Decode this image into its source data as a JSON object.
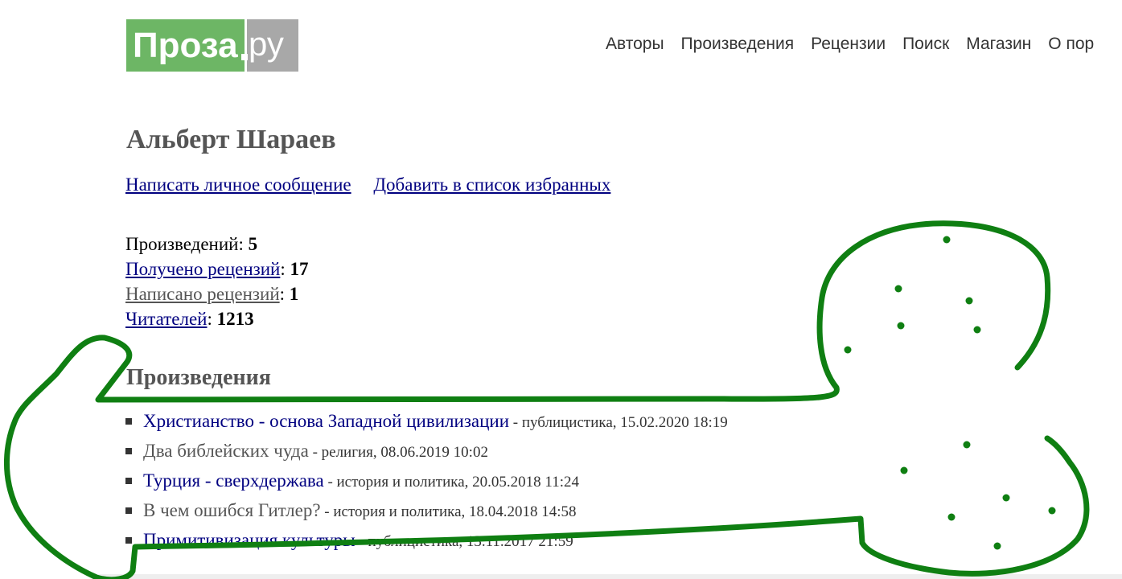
{
  "header": {
    "logo_main": "Проза",
    "logo_suffix": "ру",
    "nav": [
      "Авторы",
      "Произведения",
      "Рецензии",
      "Поиск",
      "Магазин",
      "О пор"
    ]
  },
  "author": {
    "name": "Альберт Шараев",
    "send_message": "Написать личное сообщение",
    "add_favorite": "Добавить в список избранных"
  },
  "stats": {
    "works_label": "Произведений",
    "works_value": "5",
    "reviews_received_label": "Получено рецензий",
    "reviews_received_value": "17",
    "reviews_written_label": "Написано рецензий",
    "reviews_written_value": "1",
    "readers_label": "Читателей",
    "readers_value": "1213"
  },
  "works_section": {
    "title": "Произведения",
    "items": [
      {
        "title": "Христианство - основа Западной цивилизации",
        "meta": " - публицистика, 15.02.2020 18:19"
      },
      {
        "title": "Два библейских чуда",
        "meta": " - религия, 08.06.2019 10:02"
      },
      {
        "title": "Турция - сверхдержава",
        "meta": " - история и политика, 20.05.2018 11:24"
      },
      {
        "title": "В чем ошибся Гитлер?",
        "meta": " - история и политика, 18.04.2018 14:58"
      },
      {
        "title": "Примитивизация культуры",
        "meta": " - публицистика, 13.11.2017 21:59"
      }
    ]
  },
  "colors": {
    "logo_green": "#6db665",
    "logo_gray": "#a8a8a8",
    "link": "#000080",
    "drawing": "#0f7f12"
  }
}
